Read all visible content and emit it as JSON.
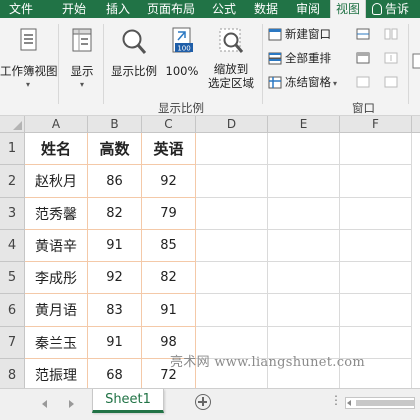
{
  "tabs": [
    "文件",
    "开始",
    "插入",
    "页面布局",
    "公式",
    "数据",
    "审阅",
    "视图"
  ],
  "active_tab": "视图",
  "tell_me": "告诉",
  "ribbon": {
    "workbook_views": "工作簿视图",
    "show": "显示",
    "zoom": "显示比例",
    "zoom_100": "100%",
    "zoom_selection_line1": "缩放到",
    "zoom_selection_line2": "选定区域",
    "group_zoom": "显示比例",
    "new_window": "新建窗口",
    "arrange_all": "全部重排",
    "freeze_panes": "冻结窗格",
    "group_window": "窗口",
    "zoom_100_badge": "100"
  },
  "columns": [
    "A",
    "B",
    "C",
    "D",
    "E",
    "F"
  ],
  "rows": [
    "1",
    "2",
    "3",
    "4",
    "5",
    "6",
    "7",
    "8"
  ],
  "table": {
    "headers": [
      "姓名",
      "高数",
      "英语"
    ],
    "data": [
      [
        "赵秋月",
        "86",
        "92"
      ],
      [
        "范秀馨",
        "82",
        "79"
      ],
      [
        "黄语辛",
        "91",
        "85"
      ],
      [
        "李成彤",
        "92",
        "82"
      ],
      [
        "黄月语",
        "83",
        "91"
      ],
      [
        "秦兰玉",
        "91",
        "98"
      ],
      [
        "范振理",
        "68",
        "72"
      ]
    ]
  },
  "watermark": "亮术网 www.liangshunet.com",
  "sheet_tab": "Sheet1",
  "colors": {
    "excel_green": "#217346",
    "table_border": "#f4c9a8"
  }
}
